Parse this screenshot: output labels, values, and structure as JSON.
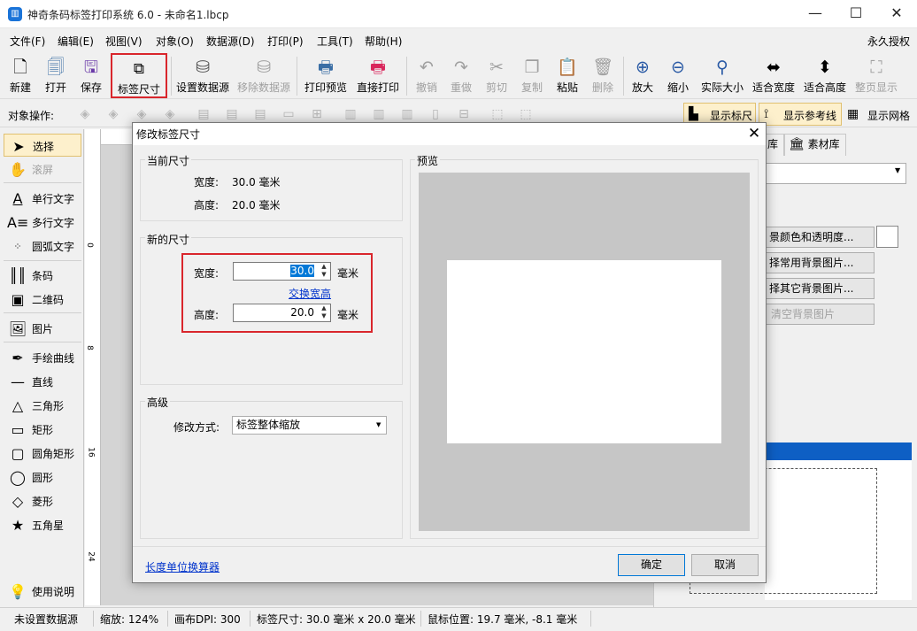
{
  "window": {
    "title": "神奇条码标签打印系统 6.0 - 未命名1.lbcp",
    "minimize": "—",
    "maximize": "☐",
    "close": "✕"
  },
  "menu": {
    "items": [
      "文件(F)",
      "编辑(E)",
      "视图(V)",
      "对象(O)",
      "数据源(D)",
      "打印(P)",
      "工具(T)",
      "帮助(H)"
    ],
    "license": "永久授权"
  },
  "toolbar": {
    "new": "新建",
    "open": "打开",
    "save": "保存",
    "label_size": "标签尺寸",
    "set_datasource": "设置数据源",
    "remove_datasource": "移除数据源",
    "print_preview": "打印预览",
    "direct_print": "直接打印",
    "undo": "撤销",
    "redo": "重做",
    "cut": "剪切",
    "copy": "复制",
    "paste": "粘贴",
    "delete": "删除",
    "zoom_in": "放大",
    "zoom_out": "缩小",
    "actual_size": "实际大小",
    "fit_width": "适合宽度",
    "fit_height": "适合高度",
    "full_page": "整页显示"
  },
  "objbar": {
    "label": "对象操作:",
    "show_ruler": "显示标尺",
    "show_guides": "显示参考线",
    "show_grid": "显示网格"
  },
  "tools": [
    "选择",
    "滚屏",
    "单行文字",
    "多行文字",
    "圆弧文字",
    "条码",
    "二维码",
    "图片",
    "手绘曲线",
    "直线",
    "三角形",
    "矩形",
    "圆角矩形",
    "圆形",
    "菱形",
    "五角星"
  ],
  "help": "使用说明",
  "ruler": {
    "v_marks": [
      "0",
      "8",
      "16",
      "24"
    ]
  },
  "right_panel": {
    "tab_lib": "库",
    "tab_assets": "素材库",
    "bg_color_btn": "景颜色和透明度...",
    "common_bg_btn": "择常用背景图片...",
    "other_bg_btn": "择其它背景图片...",
    "clear_bg_btn": "清空背景图片"
  },
  "status": {
    "datasource": "未设置数据源",
    "zoom": "缩放: 124%",
    "dpi": "画布DPI: 300",
    "label_size": "标签尺寸: 30.0 毫米 x 20.0 毫米",
    "mouse_pos": "鼠标位置: 19.7 毫米, -8.1 毫米"
  },
  "dialog": {
    "title": "修改标签尺寸",
    "current": {
      "title": "当前尺寸",
      "width_label": "宽度:",
      "width_value": "30.0 毫米",
      "height_label": "高度:",
      "height_value": "20.0 毫米"
    },
    "new": {
      "title": "新的尺寸",
      "width_label": "宽度:",
      "width_value": "30.0",
      "unit": "毫米",
      "swap_link": "交换宽高",
      "height_label": "高度:",
      "height_value": "20.0"
    },
    "advanced": {
      "title": "高级",
      "mode_label": "修改方式:",
      "mode_value": "标签整体缩放"
    },
    "preview": {
      "title": "预览"
    },
    "unit_calc_link": "长度单位换算器",
    "ok": "确定",
    "cancel": "取消",
    "close": "✕"
  },
  "colors": {
    "highlight_red": "#d9262c",
    "link_blue": "#0033cc",
    "selection_blue": "#0078d7",
    "preview_gray": "#c6c6c6"
  }
}
